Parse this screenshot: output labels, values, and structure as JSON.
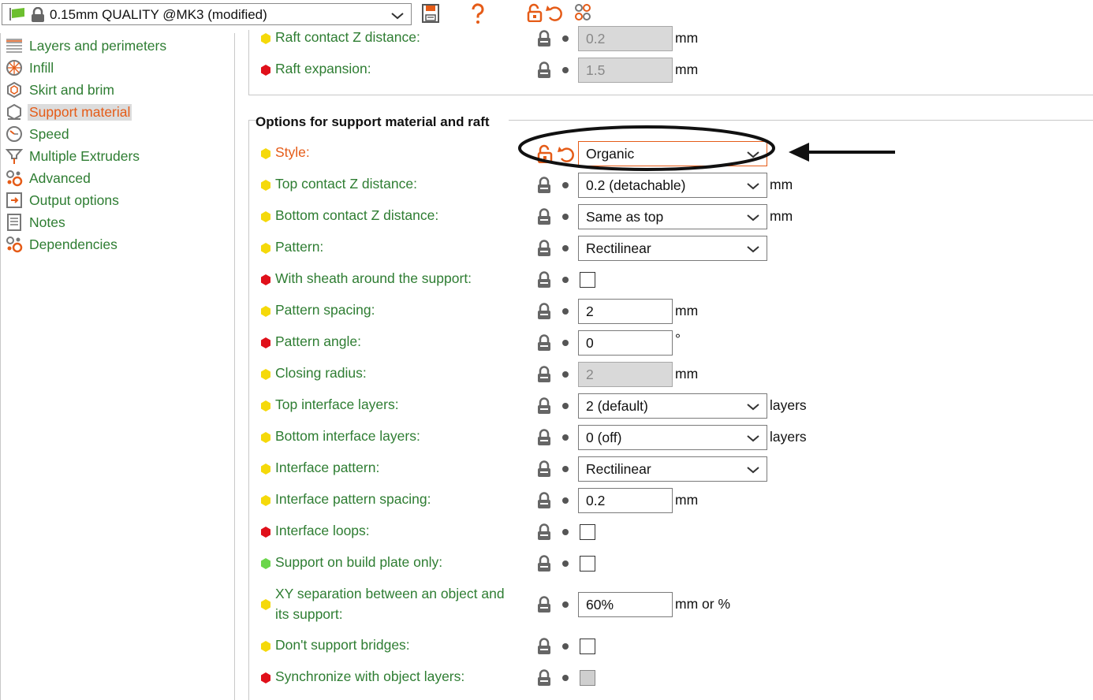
{
  "toolbar": {
    "preset_name": "0.15mm QUALITY @MK3 (modified)",
    "icons": [
      "flag-icon",
      "lock-icon",
      "chevron-down-icon",
      "save-icon",
      "help-icon",
      "unlock-icon",
      "undo-icon",
      "compare-icon"
    ]
  },
  "sidebar": {
    "items": [
      {
        "label": "Layers and perimeters",
        "icon": "layers-icon"
      },
      {
        "label": "Infill",
        "icon": "infill-icon"
      },
      {
        "label": "Skirt and brim",
        "icon": "skirt-icon"
      },
      {
        "label": "Support material",
        "icon": "support-icon",
        "active": true
      },
      {
        "label": "Speed",
        "icon": "speed-icon"
      },
      {
        "label": "Multiple Extruders",
        "icon": "extruders-icon"
      },
      {
        "label": "Advanced",
        "icon": "advanced-icon"
      },
      {
        "label": "Output options",
        "icon": "output-icon"
      },
      {
        "label": "Notes",
        "icon": "notes-icon"
      },
      {
        "label": "Dependencies",
        "icon": "dependencies-icon"
      }
    ]
  },
  "raft": {
    "contact_z": {
      "label": "Raft contact Z distance:",
      "value": "0.2",
      "unit": "mm"
    },
    "expansion": {
      "label": "Raft expansion:",
      "value": "1.5",
      "unit": "mm"
    }
  },
  "options": {
    "title": "Options for support material and raft",
    "style": {
      "label": "Style:",
      "value": "Organic"
    },
    "top_contact_z": {
      "label": "Top contact Z distance:",
      "value": "0.2 (detachable)",
      "unit": "mm"
    },
    "bottom_contact_z": {
      "label": "Bottom contact Z distance:",
      "value": "Same as top",
      "unit": "mm"
    },
    "pattern": {
      "label": "Pattern:",
      "value": "Rectilinear"
    },
    "sheath": {
      "label": "With sheath around the support:"
    },
    "pattern_spacing": {
      "label": "Pattern spacing:",
      "value": "2",
      "unit": "mm"
    },
    "pattern_angle": {
      "label": "Pattern angle:",
      "value": "0",
      "unit": "°"
    },
    "closing_radius": {
      "label": "Closing radius:",
      "value": "2",
      "unit": "mm"
    },
    "top_interface_layers": {
      "label": "Top interface layers:",
      "value": "2 (default)",
      "unit": "layers"
    },
    "bottom_interface_layers": {
      "label": "Bottom interface layers:",
      "value": "0 (off)",
      "unit": "layers"
    },
    "interface_pattern": {
      "label": "Interface pattern:",
      "value": "Rectilinear"
    },
    "interface_pattern_spacing": {
      "label": "Interface pattern spacing:",
      "value": "0.2",
      "unit": "mm"
    },
    "interface_loops": {
      "label": "Interface loops:"
    },
    "build_plate_only": {
      "label": "Support on build plate only:"
    },
    "xy_separation": {
      "label_line1": "XY separation between an object and",
      "label_line2": "its support:",
      "value": "60%",
      "unit": "mm or %"
    },
    "dont_support_bridges": {
      "label": "Don't support bridges:"
    },
    "sync_layers": {
      "label": "Synchronize with object layers:"
    }
  },
  "colors": {
    "label_green": "#2e7d32",
    "modified_orange": "#e55b17",
    "simple_yellow": "#f5d90a",
    "expert_red": "#e0101a",
    "basic_green": "#6ad64a"
  }
}
